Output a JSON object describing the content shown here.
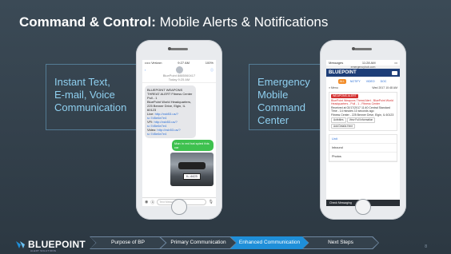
{
  "title": {
    "bold": "Command & Control:",
    "rest": " Mobile Alerts & Notifications"
  },
  "callouts": {
    "left": [
      "Instant Text,",
      "E-mail, Voice",
      "Communication"
    ],
    "right": [
      "Emergency",
      "Mobile",
      "Command",
      "Center"
    ]
  },
  "phone1": {
    "status_left": "••••• Verizon",
    "status_time": "9:27 AM",
    "status_right": "100%",
    "back": "‹",
    "contact": "BluePoint 8885060417",
    "sub": "Today 9:25 AM",
    "message_lines": [
      "BLUEPOINT WEAPONS",
      "THREAT ALERT Fitness Center",
      "Pull - 1",
      "BluePoint World Headquarters,",
      "225 Benner Drive, Elgin, IL",
      "60123"
    ],
    "links": [
      {
        "label": "Live:",
        "url": "http://xsb53.us/?s=7d5e6e7e4"
      },
      {
        "label": "VFI:",
        "url": "http://xsb53.us/?s=7d5e6e7e4"
      },
      {
        "label": "Video:",
        "url": "http://xsb53.us/?s=7d5e6e7e4"
      }
    ],
    "reply": "Man in red hat spied this car",
    "plate": "IL-4423",
    "compose_placeholder": "Text Message"
  },
  "phone2": {
    "status_left": "Messages",
    "status_time": "11:28 AM",
    "url": "emergencyhub.com",
    "brand": "BLUEPOINT",
    "tabs": [
      "ALL",
      "NOTIFY",
      "VIDEO",
      "DOC"
    ],
    "menu_label": "≡ Menu",
    "meta_right": "Wed 2017 10:48 AM",
    "tag": "WEAPONS ALERT",
    "alert_title": "BluePoint Weapons Threat Alert - BluePoint World Headquarters - Pull - 1 - Fitness Center",
    "alert_body": "Received at 02/17/2017 11:40 Central Standard Time - 14 minutes 10 seconds ago",
    "alert_location": "Fitness Center - 225 Benner Drive, Elgin, IL 60123",
    "btn_activities": "Activities",
    "btn_view": "View Full Information",
    "btn_details": "Add Details Here",
    "list": [
      "Unit",
      "Inbound",
      "Photos"
    ],
    "bottom": "Check Messaging"
  },
  "footer": {
    "logo": "BLUEPOINT",
    "logo_sub": "ALERT SOLUTIONS",
    "crumbs": [
      "Purpose of BP",
      "Primary Communication",
      "Enhanced Communication",
      "Next Steps"
    ],
    "active_crumb": 2,
    "page": "8"
  },
  "colors": {
    "accent": "#1f8fd9",
    "callout_text": "#8fd0f0",
    "background": "#33404b"
  }
}
